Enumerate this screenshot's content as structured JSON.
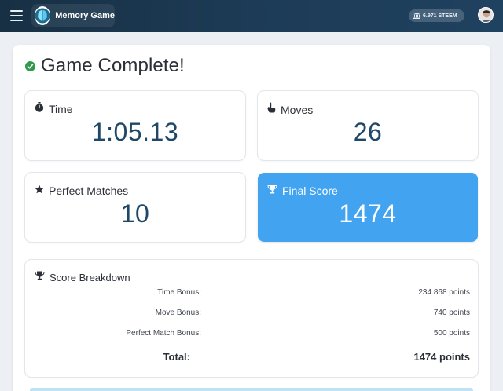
{
  "header": {
    "app_title": "Memory Game",
    "wallet_balance": "6.971 STEEM",
    "menu_icon": "hamburger-menu-icon",
    "logo_icon": "brain-logo-icon",
    "wallet_icon": "bank-icon",
    "avatar_icon": "user-avatar"
  },
  "main": {
    "title": "Game Complete!",
    "stats": {
      "time": {
        "label": "Time",
        "value": "1:05.13",
        "icon": "stopwatch-icon"
      },
      "moves": {
        "label": "Moves",
        "value": "26",
        "icon": "hand-pointer-icon"
      },
      "perfect": {
        "label": "Perfect Matches",
        "value": "10",
        "icon": "star-icon"
      },
      "final": {
        "label": "Final Score",
        "value": "1474",
        "icon": "trophy-icon"
      }
    },
    "breakdown": {
      "title": "Score Breakdown",
      "rows": [
        {
          "label": "Time Bonus:",
          "value": "234.868 points"
        },
        {
          "label": "Move Bonus:",
          "value": "740 points"
        },
        {
          "label": "Perfect Match Bonus:",
          "value": "500 points"
        }
      ],
      "total_label": "Total:",
      "total_value": "1474 points"
    }
  },
  "colors": {
    "header_bg": "#1d3b56",
    "accent": "#42a4f0",
    "value_text": "#1f4868",
    "success": "#2e9b4a"
  }
}
